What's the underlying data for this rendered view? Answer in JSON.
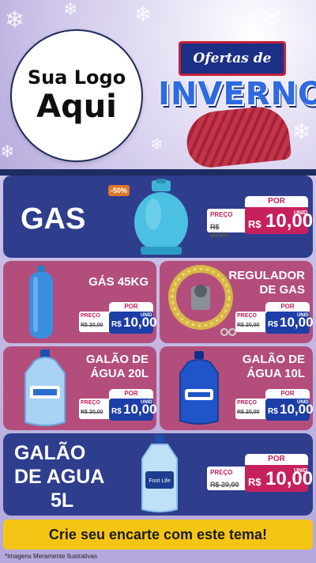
{
  "header": {
    "logo_line1": "Sua Logo",
    "logo_line2": "Aqui",
    "ofertas": "Ofertas de",
    "inverno": "INVERNO"
  },
  "products": [
    {
      "title": "GAS",
      "badge": "-50%",
      "por": "POR",
      "preco": "PREÇO",
      "old_price": "R$ 20,00",
      "rs": "R$",
      "amount": "10,00",
      "unid": "UNID",
      "icon": "gas-cylinder-icon"
    },
    {
      "title": "GÁS 45KG",
      "por": "POR",
      "preco": "PREÇO",
      "old_price": "R$ 20,00",
      "rs": "R$",
      "amount": "10,00",
      "unid": "UNID",
      "icon": "tall-gas-cylinder-icon"
    },
    {
      "title_line1": "REGULADOR",
      "title_line2": "DE GAS",
      "por": "POR",
      "preco": "PREÇO",
      "old_price": "R$ 20,00",
      "rs": "R$",
      "amount": "10,00",
      "unid": "UNID",
      "icon": "gas-regulator-icon"
    },
    {
      "title_line1": "GALÃO DE",
      "title_line2": "ÁGUA 20L",
      "por": "POR",
      "preco": "PREÇO",
      "old_price": "R$ 20,00",
      "rs": "R$",
      "amount": "10,00",
      "unid": "UNID",
      "icon": "water-jug-20l-icon"
    },
    {
      "title_line1": "GALÃO DE",
      "title_line2": "ÁGUA 10L",
      "por": "POR",
      "preco": "PREÇO",
      "old_price": "R$ 20,00",
      "rs": "R$",
      "amount": "10,00",
      "unid": "UNID",
      "icon": "water-jug-10l-icon"
    },
    {
      "title_line1": "GALÃO",
      "title_line2": "DE AGUA",
      "title_line3": "5L",
      "por": "POR",
      "preco": "PREÇO",
      "old_price": "R$ 20,00",
      "rs": "R$",
      "amount": "10,00",
      "unid": "UNID",
      "icon": "water-bottle-5l-icon",
      "bottle_label": "Font Life"
    }
  ],
  "cta": "Crie seu encarte com este tema!",
  "disclaimer": "*Imagens Meramente Ilustrativas",
  "colors": {
    "blue_card": "#2f3d8d",
    "pink_card": "#b34e7c",
    "magenta": "#c6205d",
    "navy": "#1d3ea6",
    "cta": "#f5c515"
  }
}
